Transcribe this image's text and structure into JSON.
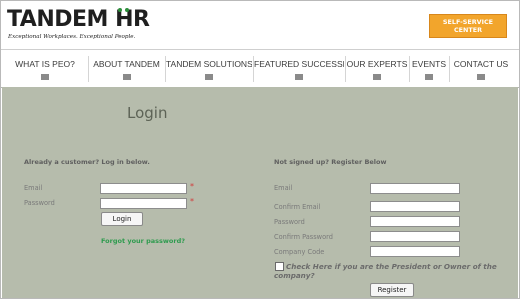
{
  "header": {
    "logo_prefix": "TANDE",
    "logo_m": "M",
    "logo_suffix": " HR",
    "tagline": "Exceptional Workplaces. Exceptional People.",
    "self_service_line1": "SELF-SERVICE",
    "self_service_line2": "CENTER",
    "accent_color": "#f2a52c",
    "logo_dot_color": "#2d8f3b"
  },
  "nav": {
    "items": [
      {
        "label": "WHAT IS PEO?"
      },
      {
        "label": "ABOUT TANDEM"
      },
      {
        "label": "TANDEM SOLUTIONS"
      },
      {
        "label": "FEATURED SUCCESSES"
      },
      {
        "label": "OUR EXPERTS"
      },
      {
        "label": "EVENTS"
      },
      {
        "label": "CONTACT US"
      }
    ]
  },
  "login": {
    "title": "Login",
    "heading": "Already a customer? Log in below.",
    "email_label": "Email",
    "password_label": "Password",
    "email_value": "",
    "password_value": "",
    "required_mark": "*",
    "button_label": "Login",
    "forgot_link": "Forgot your password?"
  },
  "register": {
    "heading": "Not signed up? Register Below",
    "email_label": "Email",
    "confirm_email_label": "Confirm Email",
    "password_label": "Password",
    "confirm_password_label": "Confirm Password",
    "company_code_label": "Company Code",
    "president_checkbox_label": "Check Here if you are the President or Owner of the company?",
    "button_label": "Register"
  },
  "colors": {
    "content_background": "#b6bcac",
    "link_green": "#2e9b4e",
    "required_red": "#d23b3b"
  }
}
